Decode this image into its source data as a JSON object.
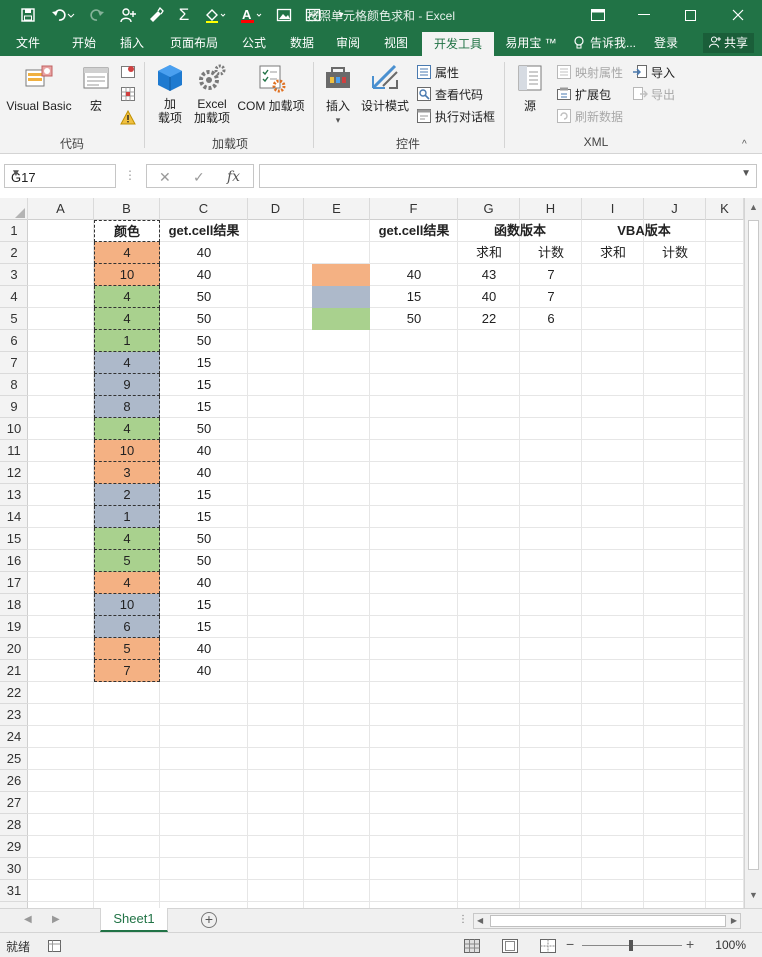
{
  "window": {
    "title": "按照单元格颜色求和 - Excel"
  },
  "ribbon_tabs": [
    {
      "label": "文件"
    },
    {
      "label": "开始"
    },
    {
      "label": "插入"
    },
    {
      "label": "页面布局"
    },
    {
      "label": "公式"
    },
    {
      "label": "数据"
    },
    {
      "label": "审阅"
    },
    {
      "label": "视图"
    },
    {
      "label": "开发工具",
      "active": true
    },
    {
      "label": "易用宝 ™"
    },
    {
      "label": "告诉我..."
    },
    {
      "label": "登录"
    }
  ],
  "share_label": "共享",
  "ribbon": {
    "code": {
      "visual_basic": "Visual Basic",
      "macro": "宏",
      "group": "代码"
    },
    "addins": {
      "addins_l1": "加",
      "addins_l2": "载项",
      "excel_l1": "Excel",
      "excel_l2": "加载项",
      "com": "COM 加载项",
      "group": "加载项"
    },
    "controls": {
      "insert": "插入",
      "design": "设计模式",
      "props": "属性",
      "view_code": "查看代码",
      "run_dialog": "执行对话框",
      "group": "控件"
    },
    "xml": {
      "source": "源",
      "map_props": "映射属性",
      "ext_pack": "扩展包",
      "refresh": "刷新数据",
      "import": "导入",
      "export": "导出",
      "group": "XML"
    }
  },
  "formula_bar": {
    "name_box": "G17",
    "formula": ""
  },
  "columns": [
    "A",
    "B",
    "C",
    "D",
    "E",
    "F",
    "G",
    "H",
    "I",
    "J",
    "K"
  ],
  "rows": [
    "1",
    "2",
    "3",
    "4",
    "5",
    "6",
    "7",
    "8",
    "9",
    "10",
    "11",
    "12",
    "13",
    "14",
    "15",
    "16",
    "17",
    "18",
    "19",
    "20",
    "21",
    "22",
    "23",
    "24",
    "25",
    "26",
    "27",
    "28",
    "29",
    "30",
    "31"
  ],
  "colors": {
    "orange": "#f4b183",
    "blue": "#adb9ca",
    "green": "#a9d18e",
    "accent": "#217346"
  },
  "table": {
    "header_color": "颜色",
    "header_getcell": "get.cell结果",
    "rows": [
      {
        "value": "4",
        "result": "40",
        "color": "orange"
      },
      {
        "value": "10",
        "result": "40",
        "color": "orange"
      },
      {
        "value": "4",
        "result": "50",
        "color": "green"
      },
      {
        "value": "4",
        "result": "50",
        "color": "green"
      },
      {
        "value": "1",
        "result": "50",
        "color": "green"
      },
      {
        "value": "4",
        "result": "15",
        "color": "blue"
      },
      {
        "value": "9",
        "result": "15",
        "color": "blue"
      },
      {
        "value": "8",
        "result": "15",
        "color": "blue"
      },
      {
        "value": "4",
        "result": "50",
        "color": "green"
      },
      {
        "value": "10",
        "result": "40",
        "color": "orange"
      },
      {
        "value": "3",
        "result": "40",
        "color": "orange"
      },
      {
        "value": "2",
        "result": "15",
        "color": "blue"
      },
      {
        "value": "1",
        "result": "15",
        "color": "blue"
      },
      {
        "value": "4",
        "result": "50",
        "color": "green"
      },
      {
        "value": "5",
        "result": "50",
        "color": "green"
      },
      {
        "value": "4",
        "result": "40",
        "color": "orange"
      },
      {
        "value": "10",
        "result": "15",
        "color": "blue"
      },
      {
        "value": "6",
        "result": "15",
        "color": "blue"
      },
      {
        "value": "5",
        "result": "40",
        "color": "orange"
      },
      {
        "value": "7",
        "result": "40",
        "color": "orange"
      }
    ]
  },
  "summary": {
    "header_getcell": "get.cell结果",
    "header_func": "函数版本",
    "header_vba": "VBA版本",
    "sum_label": "求和",
    "count_label": "计数",
    "vba_sum_label": "求和",
    "vba_count_label": "计数",
    "rows": [
      {
        "color": "orange",
        "code": "40",
        "sum": "43",
        "count": "7"
      },
      {
        "color": "blue",
        "code": "15",
        "sum": "40",
        "count": "7"
      },
      {
        "color": "green",
        "code": "50",
        "sum": "22",
        "count": "6"
      }
    ]
  },
  "sheet_tab": "Sheet1",
  "status": {
    "ready": "就绪",
    "zoom": "100%"
  }
}
